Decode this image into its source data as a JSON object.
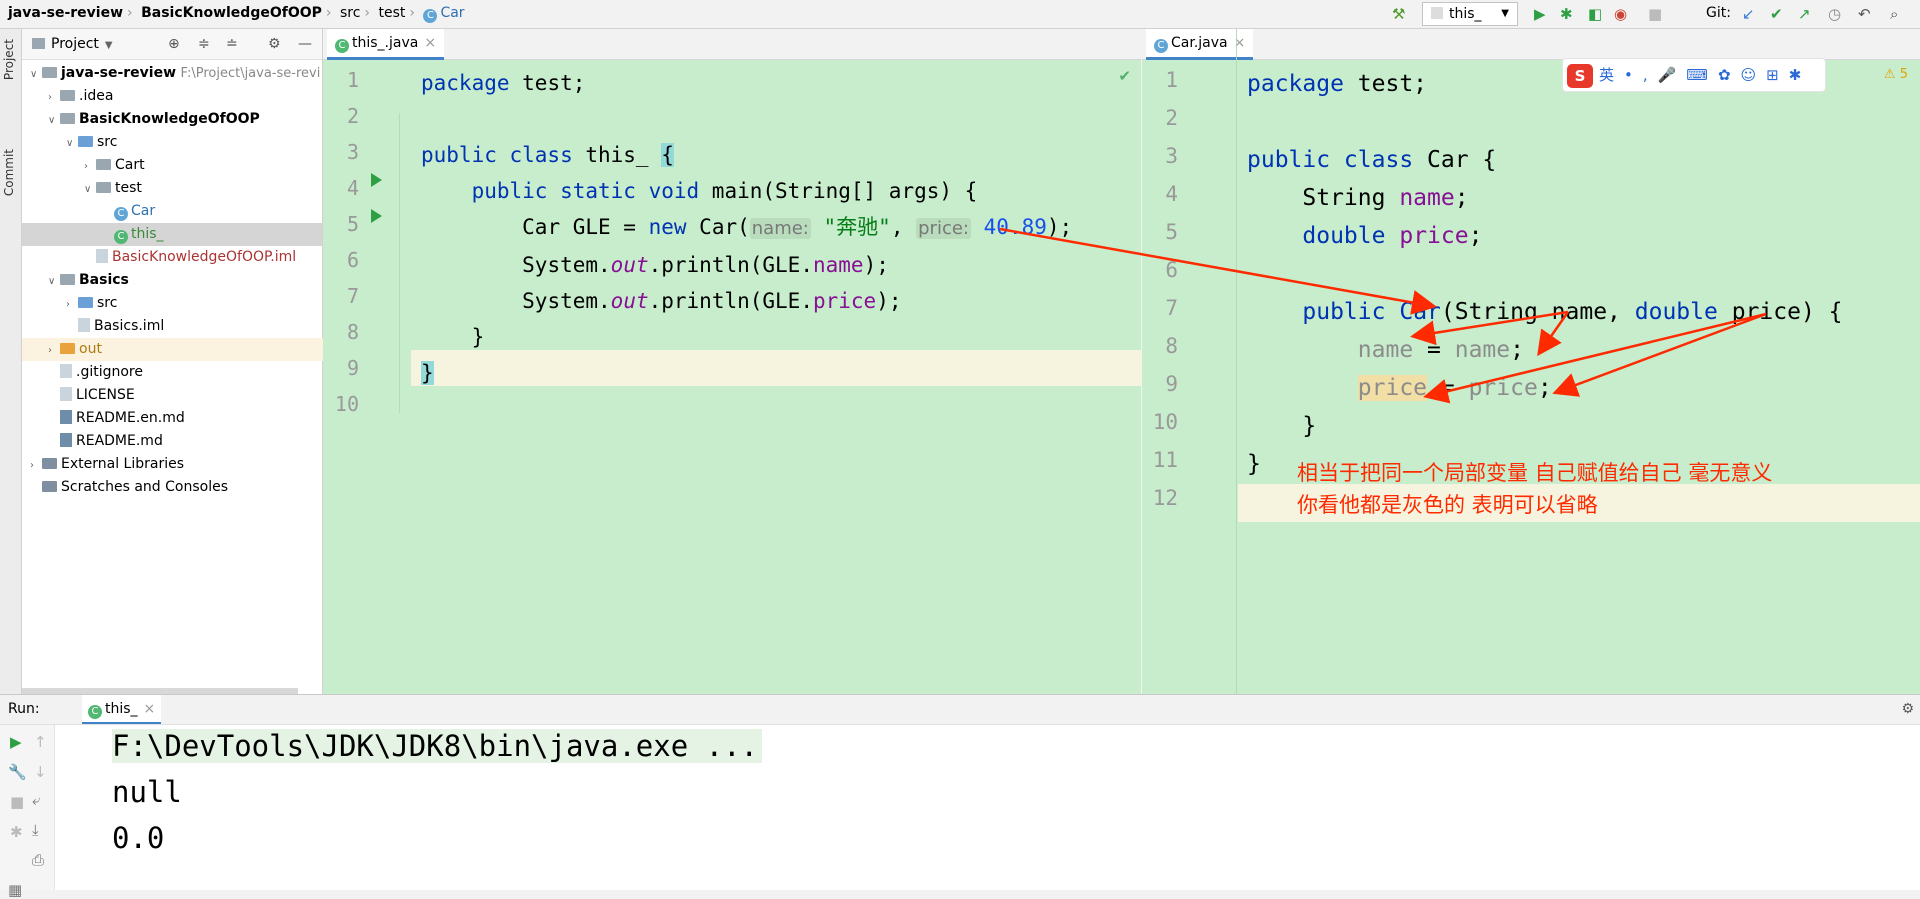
{
  "breadcrumb": {
    "root": "java-se-review",
    "module": "BasicKnowledgeOfOOP",
    "src": "src",
    "pkg": "test",
    "cls": "Car"
  },
  "toolbar": {
    "run_config": "this_",
    "git_label": "Git:"
  },
  "side_tabs": {
    "project": "Project",
    "commit": "Commit"
  },
  "project": {
    "title": "Project",
    "items": [
      {
        "label": "java-se-review",
        "path": "F:\\Project\\java-se-revi"
      },
      {
        "label": ".idea"
      },
      {
        "label": "BasicKnowledgeOfOOP"
      },
      {
        "label": "src"
      },
      {
        "label": "Cart"
      },
      {
        "label": "test"
      },
      {
        "label": "Car"
      },
      {
        "label": "this_"
      },
      {
        "label": "BasicKnowledgeOfOOP.iml"
      },
      {
        "label": "Basics"
      },
      {
        "label": "src"
      },
      {
        "label": "Basics.iml"
      },
      {
        "label": "out"
      },
      {
        "label": ".gitignore"
      },
      {
        "label": "LICENSE"
      },
      {
        "label": "README.en.md"
      },
      {
        "label": "README.md"
      },
      {
        "label": "External Libraries"
      },
      {
        "label": "Scratches and Consoles"
      }
    ]
  },
  "left_editor": {
    "tab": "this_.java",
    "line_numbers": [
      "1",
      "2",
      "3",
      "4",
      "5",
      "6",
      "7",
      "8",
      "9",
      "10"
    ],
    "code": {
      "l1_kw": "package",
      "l1_rest": " test;",
      "l3_kw": "public class",
      "l3_rest": " this_ ",
      "l3_brace": "{",
      "l4_kw": "public static void",
      "l4_rest": " main(String[] args) {",
      "l5_a": "Car GLE = ",
      "l5_new": "new",
      "l5_b": " Car(",
      "l5_hint1": "name:",
      "l5_str": "\"奔驰\"",
      "l5_c": ", ",
      "l5_hint2": "price:",
      "l5_num": "40.89",
      "l5_d": ");",
      "l6_a": "System.",
      "l6_out": "out",
      "l6_b": ".println(GLE.",
      "l6_fld": "name",
      "l6_c": ");",
      "l7_a": "System.",
      "l7_out": "out",
      "l7_b": ".println(GLE.",
      "l7_fld": "price",
      "l7_c": ");",
      "l8": "}",
      "l9": "}"
    }
  },
  "right_editor": {
    "tab": "Car.java",
    "warnings": "5",
    "line_numbers": [
      "1",
      "2",
      "3",
      "4",
      "5",
      "6",
      "7",
      "8",
      "9",
      "10",
      "11",
      "12"
    ],
    "code": {
      "l1_kw": "package",
      "l1_rest": " test;",
      "l3_kw": "public class",
      "l3_rest": " Car {",
      "l4_a": "String ",
      "l4_fld": "name",
      "l4_b": ";",
      "l5_kw": "double",
      "l5_b": " ",
      "l5_fld": "price",
      "l5_c": ";",
      "l7_kw": "public",
      "l7_b": " ",
      "l7_ctor": "Car",
      "l7_c": "(String name, ",
      "l7_kw2": "double",
      "l7_d": " price) {",
      "l8_a": "name",
      "l8_b": " = ",
      "l8_c": "name",
      "l8_d": ";",
      "l9_a": "price",
      "l9_b": " = ",
      "l9_c": "price",
      "l9_d": ";",
      "l10": "}",
      "l11": "}"
    }
  },
  "ime": {
    "logo": "S",
    "lang": "英"
  },
  "annotation": {
    "line1": "相当于把同一个局部变量 自己赋值给自己 毫无意义",
    "line2": "你看他都是灰色的 表明可以省略"
  },
  "run": {
    "label": "Run:",
    "tab": "this_",
    "console": [
      "F:\\DevTools\\JDK\\JDK8\\bin\\java.exe ...",
      "null",
      "0.0"
    ]
  },
  "colors": {
    "editor_bg": "#c7edcc",
    "keyword": "#0033b3",
    "field": "#871094",
    "string": "#067d17",
    "annotation": "#ff2a00"
  }
}
